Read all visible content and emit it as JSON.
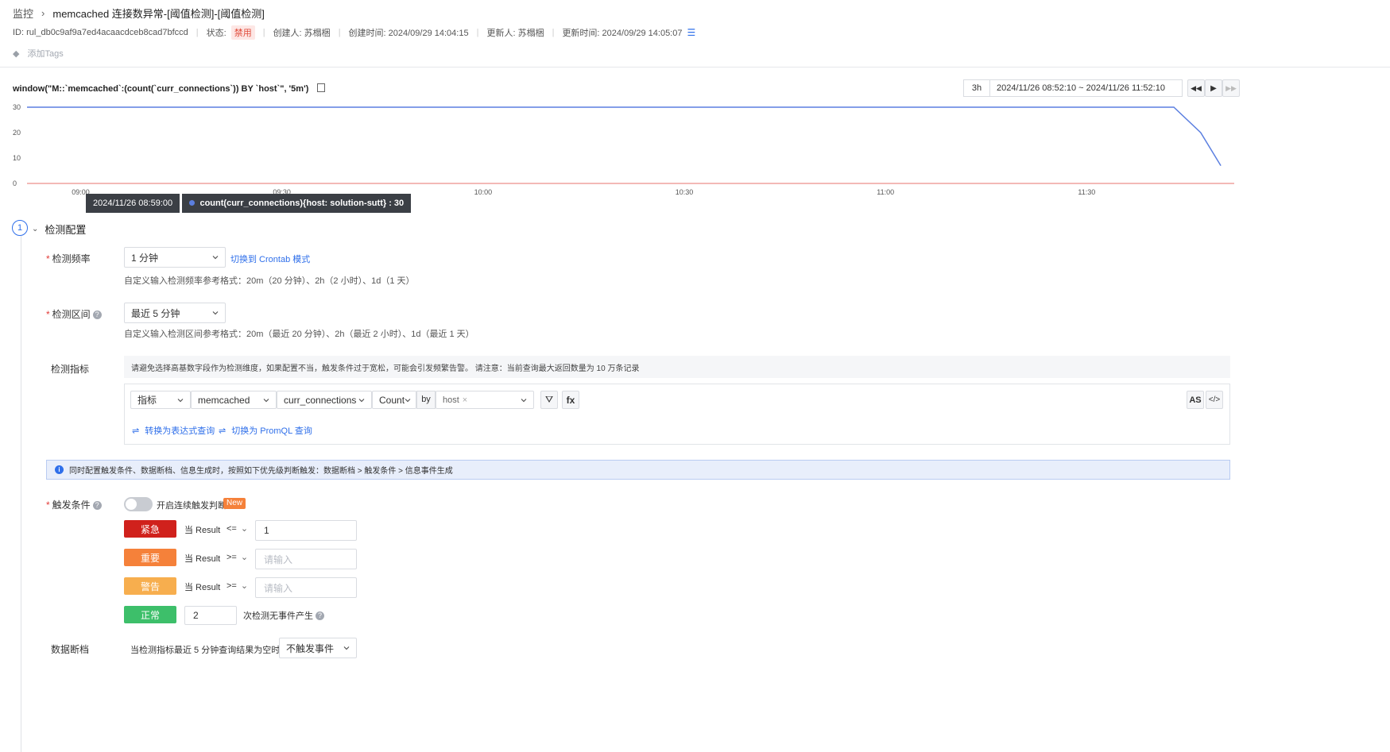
{
  "breadcrumb": {
    "root": "监控",
    "current": "memcached 连接数异常-[阈值检测]-[阈值检测]"
  },
  "meta": {
    "id": "ID: rul_db0c9af9a7ed4acaacdceb8cad7bfccd",
    "status_label": "状态:",
    "status_value": "禁用",
    "creator": "创建人: 苏榻梱",
    "created": "创建时间: 2024/09/29 14:04:15",
    "updater": "更新人: 苏榻梱",
    "updated": "更新时间: 2024/09/29 14:05:07"
  },
  "tags": {
    "add_label": "添加Tags"
  },
  "query": {
    "expression": "window(\"M::`memcached`:(count(`curr_connections`)) BY `host`\", '5m')",
    "range_button": "3h",
    "time_range": "2024/11/26 08:52:10 ~ 2024/11/26 11:52:10"
  },
  "chart_data": {
    "type": "line",
    "x": [
      "08:52",
      "08:55",
      "09:00",
      "09:30",
      "10:00",
      "10:30",
      "11:00",
      "11:30",
      "11:43",
      "11:47",
      "11:50"
    ],
    "series": [
      {
        "name": "count(curr_connections){host: solution-sutt}",
        "values": [
          30,
          30,
          30,
          30,
          30,
          30,
          30,
          30,
          30,
          20,
          7
        ]
      }
    ],
    "x_tick_labels": [
      "09:00",
      "09:30",
      "10:00",
      "10:30",
      "11:00",
      "11:30"
    ],
    "y_tick_labels": [
      "30",
      "20",
      "10",
      "0"
    ],
    "ylim": [
      0,
      30
    ],
    "grid": false,
    "line_color": "#5b7fe0",
    "tooltip_time": "2024/11/26 08:59:00",
    "tooltip_value": "count(curr_connections){host: solution-sutt} : 30"
  },
  "section": {
    "step": "1",
    "title": "检测配置"
  },
  "frequency": {
    "label": "检测频率",
    "value": "1 分钟",
    "switch_link": "切换到 Crontab 模式",
    "hint": "自定义输入检测频率参考格式：20m（20 分钟）、2h（2 小时）、1d（1 天）"
  },
  "interval": {
    "label": "检测区间",
    "value": "最近 5 分钟",
    "hint": "自定义输入检测区间参考格式：20m（最近 20 分钟）、2h（最近 2 小时）、1d（最近 1 天）"
  },
  "metric": {
    "label": "检测指标",
    "notice": "请避免选择高基数字段作为检测维度，如果配置不当，触发条件过于宽松，可能会引发频繁告警。 请注意：当前查询最大返回数量为 10 万条记录",
    "source_type": "指标",
    "measurement": "memcached",
    "field": "curr_connections",
    "agg": "Count",
    "by_label": "by",
    "by_tag": "host",
    "filter_btn": "⛛",
    "fx_btn": "fx",
    "as_btn": "AS",
    "code_btn": "</>",
    "to_expression": "转换为表达式查询",
    "to_promql": "切换为 PromQL 查询"
  },
  "info_banner": "同时配置触发条件、数据断档、信息生成时，按照如下优先级判断触发：数据断档 > 触发条件 > 信息事件生成",
  "trigger": {
    "label": "触发条件",
    "toggle_label": "开启连续触发判断",
    "new_badge": "New",
    "levels": [
      {
        "name": "紧急",
        "color": "#d0211c",
        "cond": "当 Result",
        "op": "<=",
        "value": "1",
        "placeholder": ""
      },
      {
        "name": "重要",
        "color": "#f5813a",
        "cond": "当 Result",
        "op": ">=",
        "value": "",
        "placeholder": "请输入"
      },
      {
        "name": "警告",
        "color": "#f7ae4e",
        "cond": "当 Result",
        "op": ">=",
        "value": "",
        "placeholder": "请输入"
      }
    ],
    "normal": {
      "name": "正常",
      "color": "#3dbf6a",
      "value": "2",
      "suffix": "次检测无事件产生"
    }
  },
  "nodata": {
    "label": "数据断档",
    "text": "当检测指标最近 5 分钟查询结果为空时,",
    "value": "不触发事件"
  }
}
